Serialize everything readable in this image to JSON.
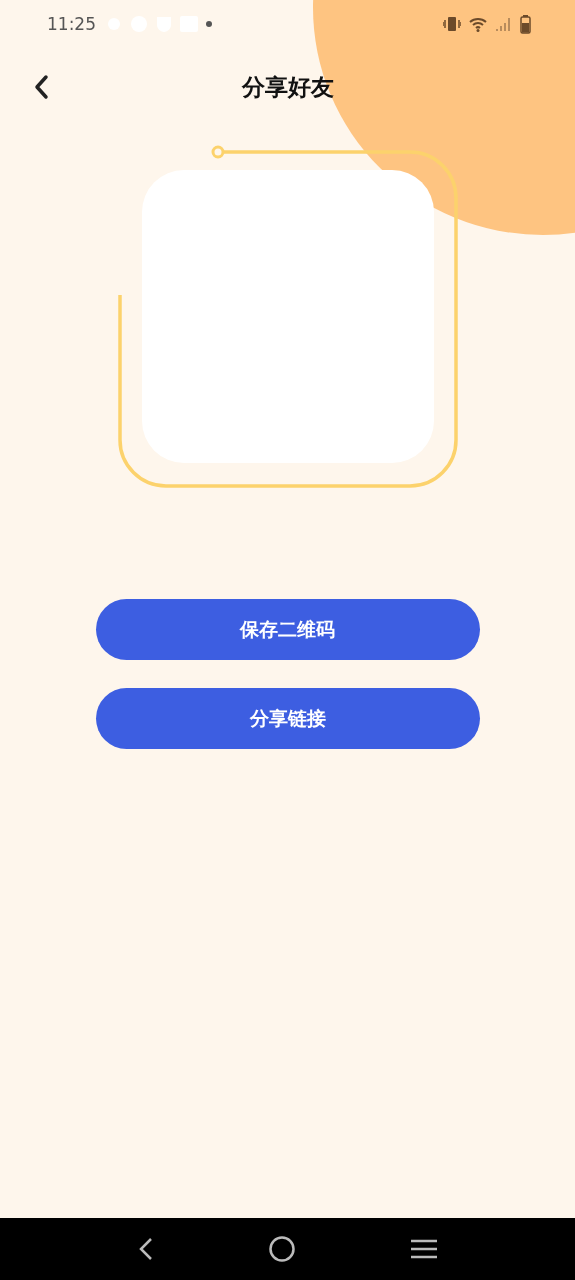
{
  "status_bar": {
    "time": "11:25"
  },
  "header": {
    "title": "分享好友"
  },
  "buttons": [
    {
      "label": "保存二维码"
    },
    {
      "label": "分享链接"
    }
  ]
}
